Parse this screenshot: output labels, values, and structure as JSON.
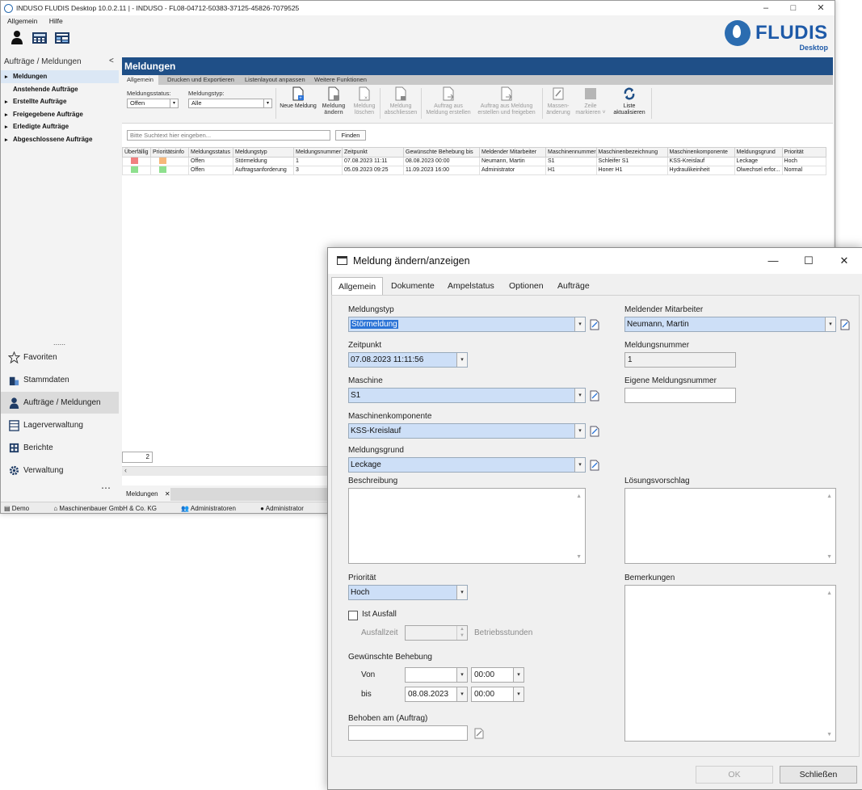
{
  "window": {
    "title": "INDUSO FLUDIS Desktop 10.0.2.11 | - INDUSO - FL08-04712-50383-37125-45826-7079525",
    "minimize": "–",
    "maximize": "□",
    "close": "✕"
  },
  "menu": {
    "allgemein": "Allgemein",
    "hilfe": "Hilfe"
  },
  "brand": {
    "name": "FLUDIS",
    "sub": "Desktop",
    "color": "#1e5aa8"
  },
  "nav": {
    "header": "Aufträge / Meldungen",
    "collapse": "<",
    "items": [
      "Meldungen",
      "Anstehende Aufträge",
      "Erstellte Aufträge",
      "Freigegebene Aufträge",
      "Erledigte Aufträge",
      "Abgeschlossene Aufträge"
    ],
    "dots": "......",
    "sections": [
      "Favoriten",
      "Stammdaten",
      "Aufträge / Meldungen",
      "Lagerverwaltung",
      "Berichte",
      "Verwaltung"
    ],
    "more": "⋯",
    "page_value": "2"
  },
  "panel": {
    "title": "Meldungen",
    "ribbon_tabs": [
      "Allgemein",
      "Drucken und Exportieren",
      "Listenlayout anpassen",
      "Weitere Funktionen"
    ],
    "status_label": "Meldungsstatus:",
    "status_value": "Offen",
    "type_label": "Meldungstyp:",
    "type_value": "Alle",
    "buttons": {
      "neu": "Neue Meldung",
      "aendern1": "Meldung",
      "aendern2": "ändern",
      "loeschen1": "Meldung",
      "loeschen2": "löschen",
      "abschl1": "Meldung",
      "abschl2": "abschliessen",
      "auftrag1": "Auftrag aus",
      "auftrag2": "Meldung erstellen",
      "freig1": "Auftrag aus Meldung",
      "freig2": "erstellen und freigeben",
      "massen1": "Massen-",
      "massen2": "änderung",
      "zeile1": "Zeile",
      "zeile2": "markieren ˅",
      "liste1": "Liste",
      "liste2": "aktualisieren"
    },
    "search_placeholder": "Bitte Suchtext hier eingeben...",
    "finden": "Finden",
    "columns": [
      "Überfällig",
      "Prioritätsinfo",
      "Meldungsstatus",
      "Meldungstyp",
      "Meldungsnummer",
      "Zeitpunkt",
      "Gewünschte Behebung bis",
      "Meldender Mitarbeiter",
      "Maschinennummer",
      "Maschinenbezeichnung",
      "Maschinenkomponente",
      "Meldungsgrund",
      "Priorität"
    ],
    "rows": [
      [
        "Offen",
        "Störmeldung",
        "1",
        "07.08.2023 11:11",
        "08.08.2023 00:00",
        "Neumann, Martin",
        "S1",
        "Schleifer S1",
        "KSS-Kreislauf",
        "Leckage",
        "Hoch"
      ],
      [
        "Offen",
        "Auftragsanforderung",
        "3",
        "05.09.2023 09:25",
        "11.09.2023 16:00",
        "Administrator",
        "H1",
        "Honer H1",
        "Hydraulikeinheit",
        "Ölwechsel erfor...",
        "Normal"
      ]
    ],
    "row_colors": [
      [
        "#f08080",
        "#f7b77a"
      ],
      [
        "#8ee08e",
        "#8ee08e"
      ]
    ]
  },
  "doc_tab": {
    "label": "Meldungen",
    "close": "✕"
  },
  "status": {
    "demo": "Demo",
    "company": "Maschinenbauer GmbH & Co. KG",
    "group": "Administratoren",
    "user": "Administrator"
  },
  "dialog": {
    "title": "Meldung ändern/anzeigen",
    "tabs": [
      "Allgemein",
      "Dokumente",
      "Ampelstatus",
      "Optionen",
      "Aufträge"
    ],
    "meldungstyp_label": "Meldungstyp",
    "meldungstyp": "Störmeldung",
    "zeitpunkt_label": "Zeitpunkt",
    "zeitpunkt": "07.08.2023 11:11:56",
    "maschine_label": "Maschine",
    "maschine": "S1",
    "komponente_label": "Maschinenkomponente",
    "komponente": "KSS-Kreislauf",
    "grund_label": "Meldungsgrund",
    "grund": "Leckage",
    "beschreibung_label": "Beschreibung",
    "mitarbeiter_label": "Meldender Mitarbeiter",
    "mitarbeiter": "Neumann, Martin",
    "nummer_label": "Meldungsnummer",
    "nummer": "1",
    "eigene_label": "Eigene Meldungsnummer",
    "loesung_label": "Lösungsvorschlag",
    "prioritaet_label": "Priorität",
    "prioritaet": "Hoch",
    "ausfall_label": "Ist Ausfall",
    "ausfallzeit_label": "Ausfallzeit",
    "betriebsstunden": "Betriebsstunden",
    "behebung_label": "Gewünschte Behebung",
    "von_label": "Von",
    "von_time": "00:00",
    "bis_label": "bis",
    "bis_date": "08.08.2023",
    "bis_time": "00:00",
    "behoben_label": "Behoben am (Auftrag)",
    "bemerkungen_label": "Bemerkungen",
    "ok": "OK",
    "schliessen": "Schließen",
    "minimize": "—",
    "maximize": "☐",
    "close": "✕"
  }
}
